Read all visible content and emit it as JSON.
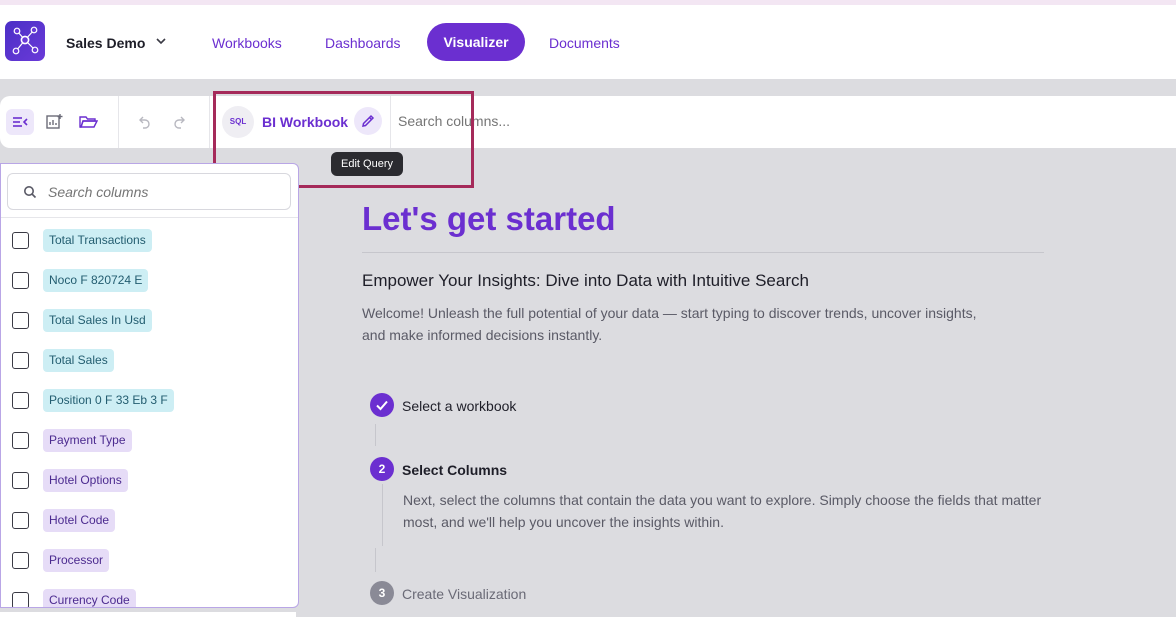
{
  "app": {
    "workspace_name": "Sales Demo",
    "nav": [
      "Workbooks",
      "Dashboards",
      "Visualizer",
      "Documents"
    ],
    "active_nav": "Visualizer",
    "accent_color": "#6b2fd0",
    "logo_icon": "graph-nodes-icon"
  },
  "toolbar": {
    "source_badge": "SQL",
    "workbook_name": "BI Workbook",
    "edit_tooltip": "Edit Query",
    "search_placeholder": "Search columns..."
  },
  "sidebar": {
    "search_placeholder": "Search columns",
    "columns": [
      {
        "label": "Total Transactions",
        "kind": "numeric"
      },
      {
        "label": "Noco F 820724 E",
        "kind": "numeric"
      },
      {
        "label": "Total Sales In Usd",
        "kind": "numeric"
      },
      {
        "label": "Total Sales",
        "kind": "numeric"
      },
      {
        "label": "Position 0 F 33 Eb 3 F",
        "kind": "numeric"
      },
      {
        "label": "Payment Type",
        "kind": "text"
      },
      {
        "label": "Hotel Options",
        "kind": "text"
      },
      {
        "label": "Hotel Code",
        "kind": "text"
      },
      {
        "label": "Processor",
        "kind": "text"
      },
      {
        "label": "Currency Code",
        "kind": "text"
      }
    ]
  },
  "main": {
    "title": "Let's get started",
    "subtitle": "Empower Your Insights: Dive into Data with Intuitive Search",
    "description": "Welcome! Unleash the full potential of your data — start typing to discover trends, uncover insights, and make informed decisions instantly.",
    "steps": [
      {
        "number": "1",
        "label": "Select a workbook",
        "status": "done"
      },
      {
        "number": "2",
        "label": "Select Columns",
        "status": "active",
        "description": "Next, select the columns that contain the data you want to explore. Simply choose the fields that matter most, and we'll help you uncover the insights within."
      },
      {
        "number": "3",
        "label": "Create Visualization",
        "status": "todo"
      }
    ]
  }
}
